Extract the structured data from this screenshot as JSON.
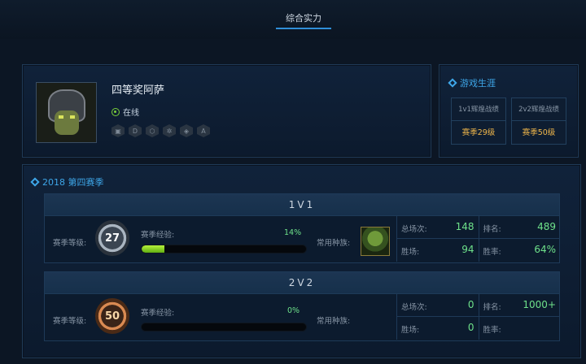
{
  "header": {
    "tab_active": "综合实力"
  },
  "profile": {
    "name": "四等奖阿萨",
    "status": "在线",
    "badges": [
      "cube-badge-icon",
      "d-badge-icon",
      "hex-badge-icon",
      "gear-badge-icon",
      "shield-badge-icon",
      "a-badge-icon"
    ]
  },
  "career": {
    "title": "游戏生涯",
    "items": [
      {
        "label": "1v1辉煌战绩",
        "value": "赛季29级"
      },
      {
        "label": "2v2辉煌战绩",
        "value": "赛季50级"
      }
    ]
  },
  "season": {
    "title": "2018 第四赛季",
    "modes": [
      {
        "name": "1V1",
        "level_label": "赛季等级:",
        "level": "27",
        "exp_label": "赛季经验:",
        "exp_pct": "14%",
        "exp_fraction": 0.14,
        "race_label": "常用种族:",
        "race_icon": "orc-portrait-icon",
        "stats": {
          "total_label": "总场次:",
          "total": "148",
          "rank_label": "排名:",
          "rank": "489",
          "wins_label": "胜场:",
          "wins": "94",
          "winrate_label": "胜率:",
          "winrate": "64%"
        }
      },
      {
        "name": "2V2",
        "level_label": "赛季等级:",
        "level": "50",
        "exp_label": "赛季经验:",
        "exp_pct": "0%",
        "exp_fraction": 0,
        "race_label": "常用种族:",
        "stats": {
          "total_label": "总场次:",
          "total": "0",
          "rank_label": "排名:",
          "rank": "1000+",
          "wins_label": "胜场:",
          "wins": "0",
          "winrate_label": "胜率:",
          "winrate": ""
        }
      }
    ]
  },
  "colors": {
    "accent": "#3ea6e8",
    "gold": "#f2b84b",
    "green": "#6ee18a",
    "panel_bg": "#10223a"
  }
}
